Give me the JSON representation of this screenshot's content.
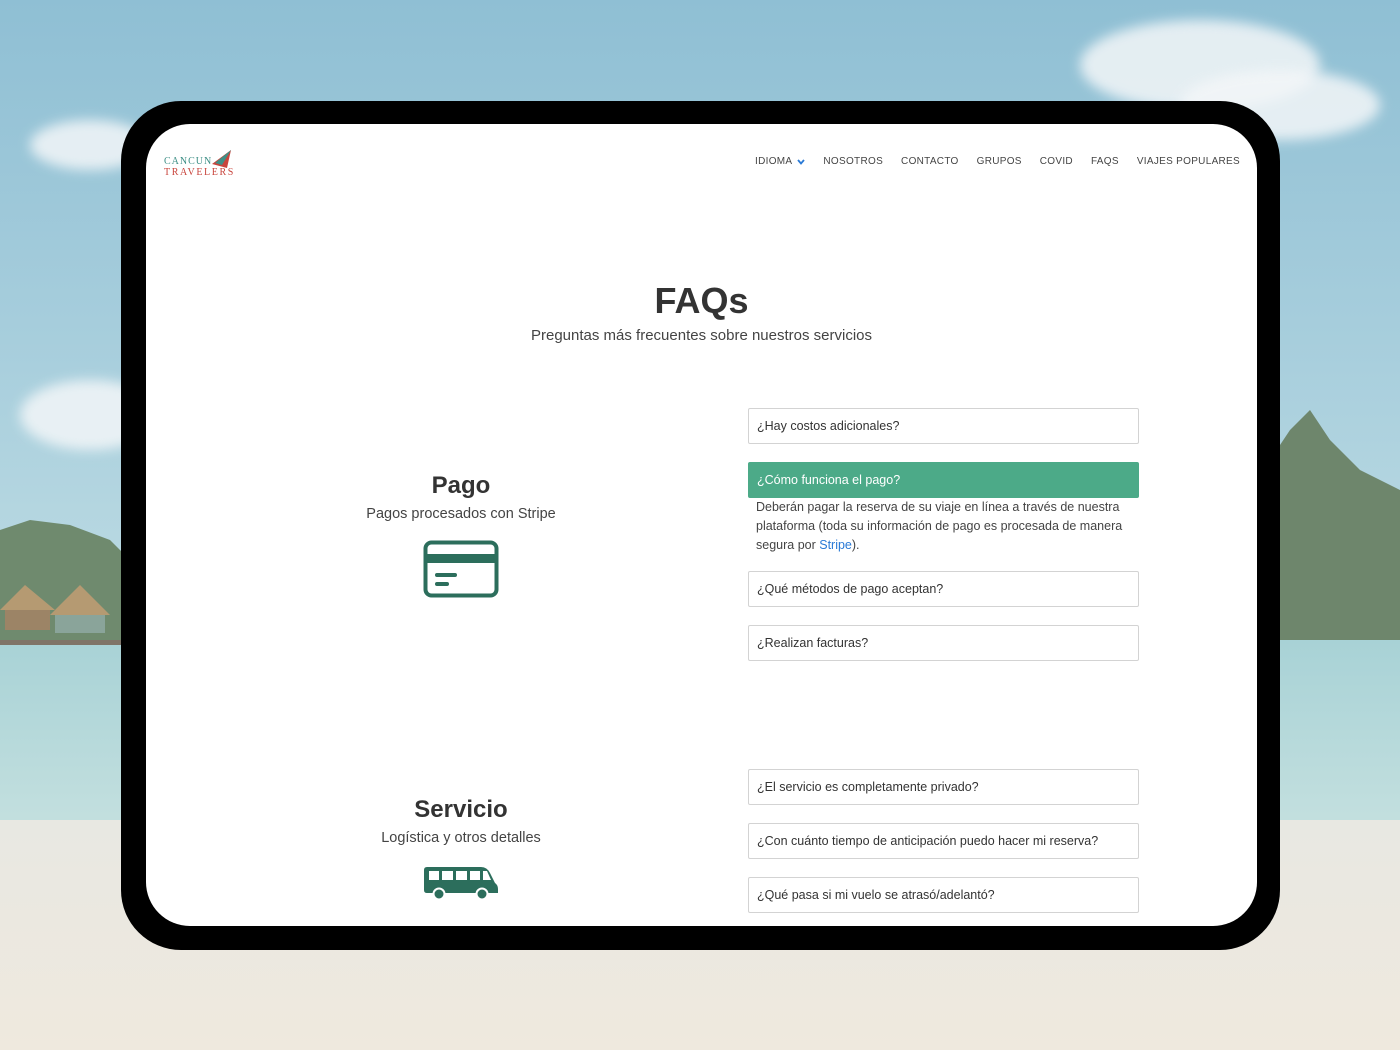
{
  "brand": {
    "line1": "CANCUN",
    "line2": "TRAVELERS"
  },
  "nav": {
    "items": [
      {
        "label": "IDIOMA",
        "dropdown": true
      },
      {
        "label": "NOSOTROS"
      },
      {
        "label": "CONTACTO"
      },
      {
        "label": "GRUPOS"
      },
      {
        "label": "COVID"
      },
      {
        "label": "FAQS"
      },
      {
        "label": "VIAJES POPULARES"
      }
    ]
  },
  "page": {
    "title": "FAQs",
    "subtitle": "Preguntas más frecuentes sobre nuestros servicios"
  },
  "sections": [
    {
      "title": "Pago",
      "subtitle": "Pagos procesados con Stripe",
      "icon": "credit-card-icon",
      "questions": [
        {
          "q": "¿Hay costos adicionales?"
        },
        {
          "q": "¿Cómo funciona el pago?",
          "active": true
        },
        {
          "q": "¿Qué métodos de pago aceptan?"
        },
        {
          "q": "¿Realizan facturas?"
        }
      ],
      "answer": {
        "before": "Deberán pagar la reserva de su viaje en línea a través de nuestra plataforma (toda su información de pago es procesada de manera segura por ",
        "link": "Stripe",
        "after": ")."
      }
    },
    {
      "title": "Servicio",
      "subtitle": "Logística y otros detalles",
      "icon": "van-icon",
      "questions": [
        {
          "q": "¿El servicio es completamente privado?"
        },
        {
          "q": "¿Con cuánto tiempo de anticipación puedo hacer mi reserva?"
        },
        {
          "q": "¿Qué pasa si mi vuelo se atrasó/adelantó?"
        }
      ]
    }
  ],
  "colors": {
    "accent": "#4caa88",
    "icon": "#2c6e5c",
    "link": "#2a7ad6",
    "brand_teal": "#3e8f86",
    "brand_red": "#c8443c"
  }
}
